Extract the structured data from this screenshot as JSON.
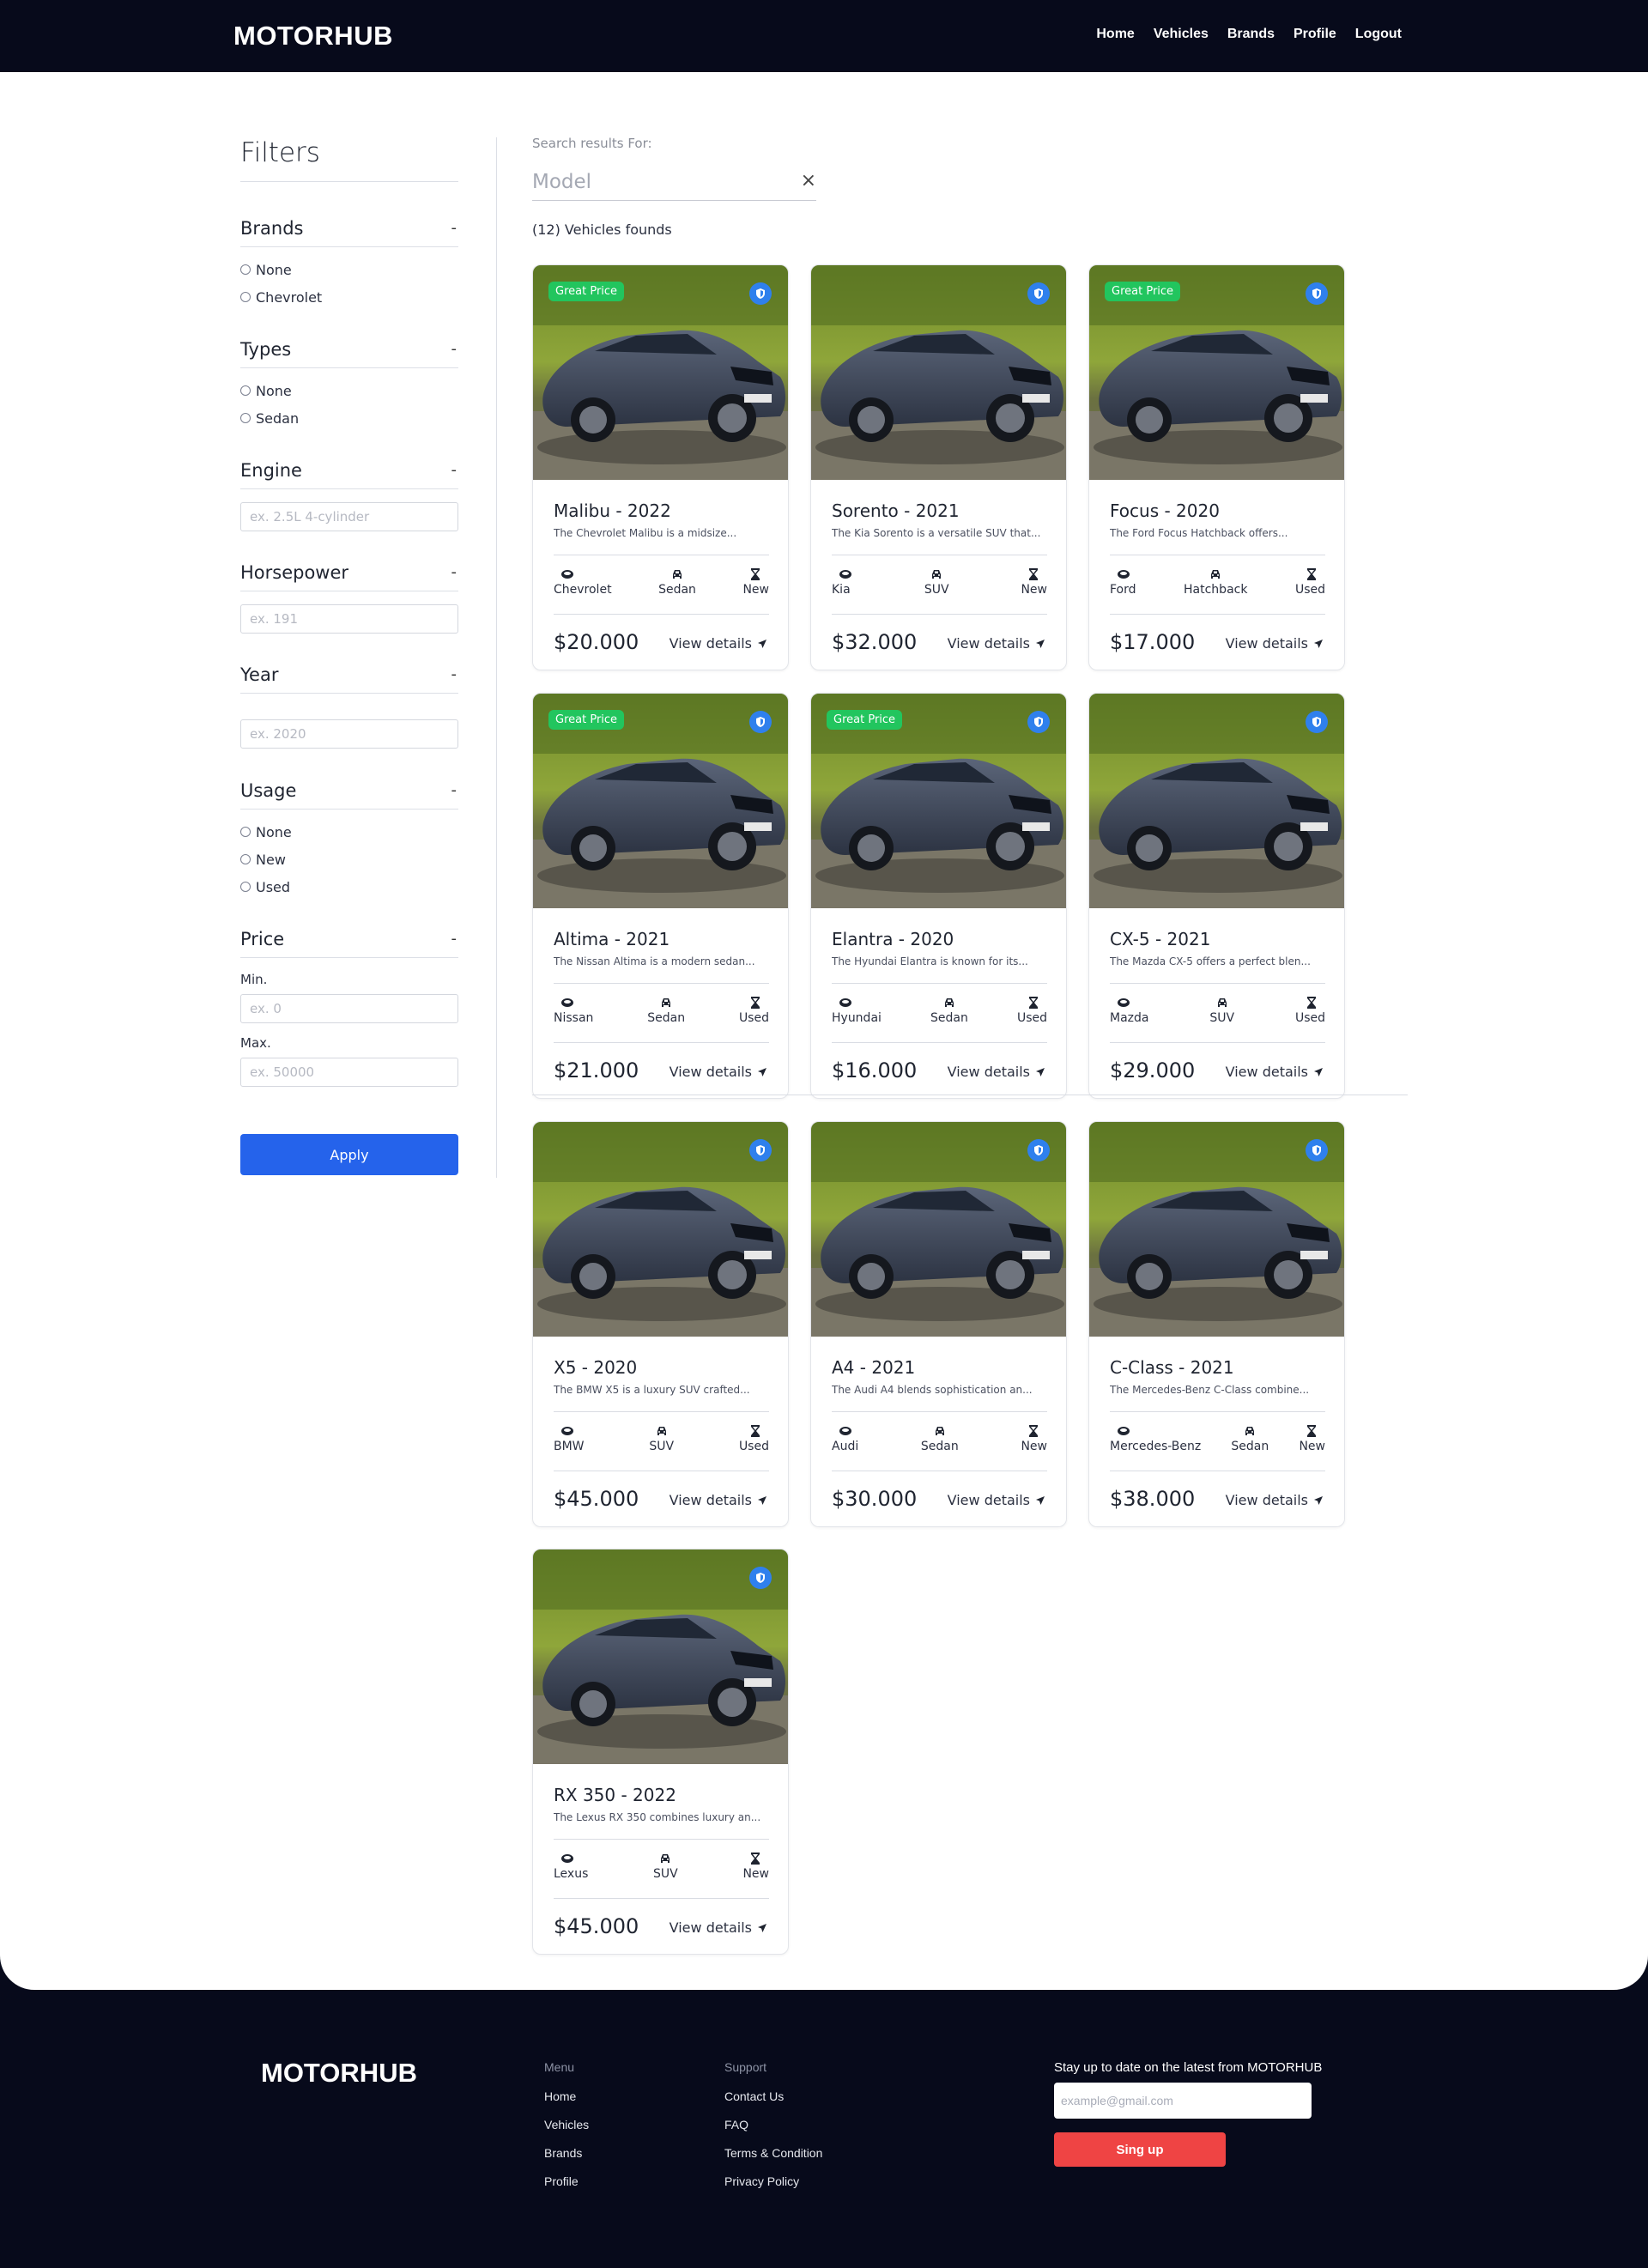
{
  "header": {
    "logo": "MOTORHUB",
    "nav": [
      "Home",
      "Vehicles",
      "Brands",
      "Profile",
      "Logout"
    ]
  },
  "filters": {
    "title": "Filters",
    "brands": {
      "label": "Brands",
      "toggle": "-",
      "options": [
        "None",
        "Chevrolet"
      ]
    },
    "types": {
      "label": "Types",
      "toggle": "-",
      "options": [
        "None",
        "Sedan"
      ]
    },
    "engine": {
      "label": "Engine",
      "toggle": "-",
      "placeholder": "ex. 2.5L 4-cylinder"
    },
    "horsepower": {
      "label": "Horsepower",
      "toggle": "-",
      "placeholder": "ex. 191"
    },
    "year": {
      "label": "Year",
      "toggle": "-",
      "placeholder": "ex. 2020"
    },
    "usage": {
      "label": "Usage",
      "toggle": "-",
      "options": [
        "None",
        "New",
        "Used"
      ]
    },
    "price": {
      "label": "Price",
      "toggle": "-",
      "min_label": "Min.",
      "min_placeholder": "ex. 0",
      "max_label": "Max.",
      "max_placeholder": "ex. 50000"
    },
    "apply_label": "Apply"
  },
  "results": {
    "label": "Search results For:",
    "search_placeholder": "Model",
    "clear": "×",
    "count_text": "(12) Vehicles founds"
  },
  "cards": [
    {
      "title": "Malibu - 2022",
      "desc": "The Chevrolet Malibu is a midsize...",
      "brand": "Chevrolet",
      "type": "Sedan",
      "usage": "New",
      "price": "$20.000",
      "great": true
    },
    {
      "title": "Sorento - 2021",
      "desc": "The Kia Sorento is a versatile SUV that...",
      "brand": "Kia",
      "type": "SUV",
      "usage": "New",
      "price": "$32.000",
      "great": false
    },
    {
      "title": "Focus - 2020",
      "desc": "The Ford Focus Hatchback offers...",
      "brand": "Ford",
      "type": "Hatchback",
      "usage": "Used",
      "price": "$17.000",
      "great": true
    },
    {
      "title": "Altima - 2021",
      "desc": "The Nissan Altima is a modern sedan...",
      "brand": "Nissan",
      "type": "Sedan",
      "usage": "Used",
      "price": "$21.000",
      "great": true
    },
    {
      "title": "Elantra - 2020",
      "desc": "The Hyundai Elantra is known for its...",
      "brand": "Hyundai",
      "type": "Sedan",
      "usage": "Used",
      "price": "$16.000",
      "great": true
    },
    {
      "title": "CX-5 - 2021",
      "desc": "The Mazda CX-5 offers a perfect blen...",
      "brand": "Mazda",
      "type": "SUV",
      "usage": "Used",
      "price": "$29.000",
      "great": false
    },
    {
      "title": "X5 - 2020",
      "desc": "The BMW X5 is a luxury SUV crafted...",
      "brand": "BMW",
      "type": "SUV",
      "usage": "Used",
      "price": "$45.000",
      "great": false
    },
    {
      "title": "A4 - 2021",
      "desc": "The Audi A4 blends sophistication an...",
      "brand": "Audi",
      "type": "Sedan",
      "usage": "New",
      "price": "$30.000",
      "great": false
    },
    {
      "title": "C-Class - 2021",
      "desc": "The Mercedes-Benz C-Class combine...",
      "brand": "Mercedes-Benz",
      "type": "Sedan",
      "usage": "New",
      "price": "$38.000",
      "great": false
    },
    {
      "title": "RX 350 - 2022",
      "desc": "The Lexus RX 350 combines luxury an...",
      "brand": "Lexus",
      "type": "SUV",
      "usage": "New",
      "price": "$45.000",
      "great": false
    }
  ],
  "card_labels": {
    "great_price": "Great Price",
    "view_details": "View details"
  },
  "footer": {
    "logo": "MOTORHUB",
    "menu": {
      "heading": "Menu",
      "links": [
        "Home",
        "Vehicles",
        "Brands",
        "Profile"
      ]
    },
    "support": {
      "heading": "Support",
      "links": [
        "Contact Us",
        "FAQ",
        "Terms & Condition",
        "Privacy Policy"
      ]
    },
    "newsletter": {
      "title": "Stay up to date on the latest from MOTORHUB",
      "placeholder": "example@gmail.com",
      "button": "Sing up"
    }
  },
  "colors": {
    "navy": "#070a1b",
    "primary_blue": "#2563eb",
    "great_price_green": "#22c55e",
    "shield_blue": "#2f80ed",
    "signup_red": "#ef4444"
  },
  "icons": {
    "brand": "tire-icon",
    "type": "car-icon",
    "usage": "hourglass-icon",
    "view": "navigation-arrow-icon",
    "badge": "shield-icon"
  }
}
